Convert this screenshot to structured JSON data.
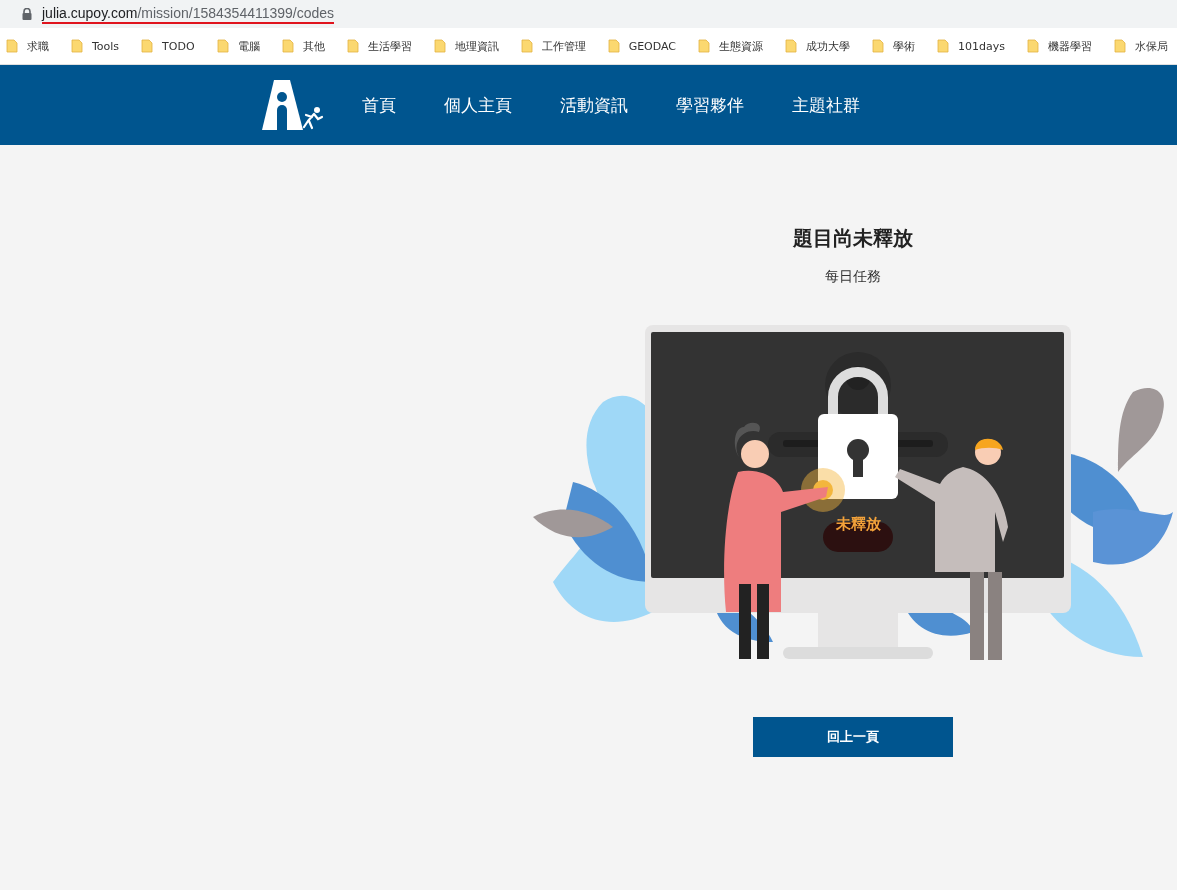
{
  "browser": {
    "url_host": "julia.cupoy.com",
    "url_path": "/mission/1584354411399/codes"
  },
  "bookmarks": [
    "求職",
    "Tools",
    "TODO",
    "電腦",
    "其他",
    "生活學習",
    "地理資訊",
    "工作管理",
    "GEODAC",
    "生態資源",
    "成功大學",
    "學術",
    "101days",
    "機器學習",
    "水保局"
  ],
  "nav": {
    "items": [
      "首頁",
      "個人主頁",
      "活動資訊",
      "學習夥伴",
      "主題社群"
    ]
  },
  "main": {
    "title": "題目尚未釋放",
    "subtitle": "每日任務",
    "illustration_label": "未釋放",
    "back_button": "回上一頁"
  }
}
